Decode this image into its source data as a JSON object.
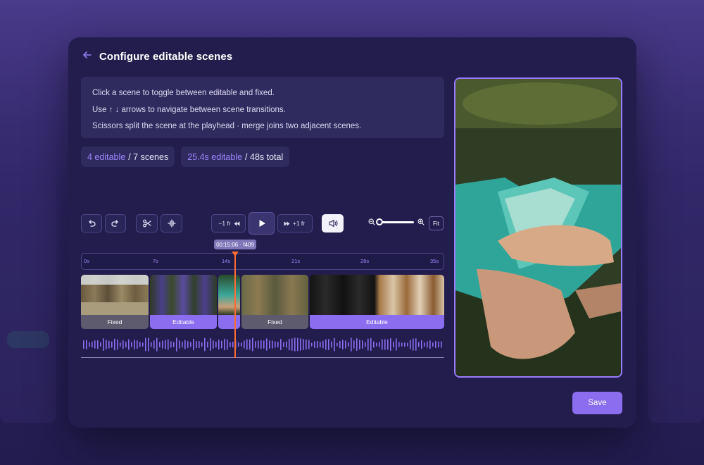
{
  "modal": {
    "title": "Configure editable scenes"
  },
  "instructions": [
    "Click a scene to toggle between editable and fixed.",
    "Use ↑ ↓ arrows to navigate between scene transitions.",
    "Scissors split the scene at the playhead · merge joins two adjacent scenes."
  ],
  "stats": {
    "editable_count": "4 editable",
    "scenes_total": "/ 7 scenes",
    "editable_duration": "25.4s editable",
    "duration_total": "/ 48s total"
  },
  "toolbar": {
    "prev_frame_label": "−1 fr",
    "next_frame_label": "+1 fr",
    "fit_label": "Fit",
    "zoom_level": 0
  },
  "timeline": {
    "playhead_label": "00:15:06 · f409",
    "ticks": [
      "0s",
      "7s",
      "14s",
      "21s",
      "28s",
      "35s"
    ],
    "clips": [
      {
        "label": "Fixed",
        "state": "fixed"
      },
      {
        "label": "Editable",
        "state": "editable"
      },
      {
        "label": "",
        "state": "editable"
      },
      {
        "label": "Fixed",
        "state": "fixed"
      },
      {
        "label": "Editable",
        "state": "editable"
      }
    ]
  },
  "actions": {
    "save_label": "Save"
  },
  "colors": {
    "accent": "#8b6df0",
    "playhead": "#ff6b35",
    "modal_bg": "#221d4d"
  }
}
